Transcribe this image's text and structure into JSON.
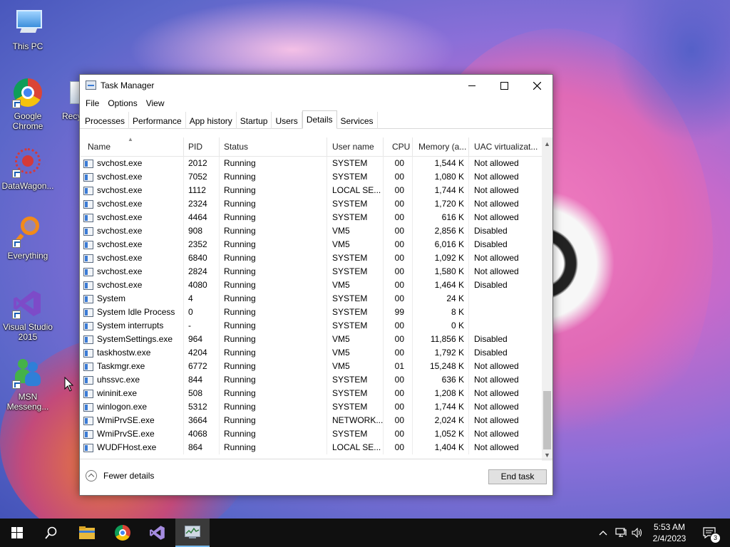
{
  "desktop": {
    "icons": [
      {
        "label": "This PC"
      },
      {
        "label": "Google Chrome"
      },
      {
        "label": "Recy"
      },
      {
        "label": "DataWagon..."
      },
      {
        "label": "Everything"
      },
      {
        "label": "Visual Studio 2015"
      },
      {
        "label": "MSN Messeng..."
      }
    ]
  },
  "window": {
    "title": "Task Manager",
    "menu": [
      "File",
      "Options",
      "View"
    ],
    "tabs": [
      "Processes",
      "Performance",
      "App history",
      "Startup",
      "Users",
      "Details",
      "Services"
    ],
    "active_tab": "Details",
    "columns": {
      "name": "Name",
      "pid": "PID",
      "status": "Status",
      "user": "User name",
      "cpu": "CPU",
      "memory": "Memory (a...",
      "uac": "UAC virtualizat..."
    },
    "rows": [
      {
        "name": "svchost.exe",
        "pid": "2012",
        "status": "Running",
        "user": "SYSTEM",
        "cpu": "00",
        "mem": "1,544 K",
        "uac": "Not allowed"
      },
      {
        "name": "svchost.exe",
        "pid": "7052",
        "status": "Running",
        "user": "SYSTEM",
        "cpu": "00",
        "mem": "1,080 K",
        "uac": "Not allowed"
      },
      {
        "name": "svchost.exe",
        "pid": "1112",
        "status": "Running",
        "user": "LOCAL SE...",
        "cpu": "00",
        "mem": "1,744 K",
        "uac": "Not allowed"
      },
      {
        "name": "svchost.exe",
        "pid": "2324",
        "status": "Running",
        "user": "SYSTEM",
        "cpu": "00",
        "mem": "1,720 K",
        "uac": "Not allowed"
      },
      {
        "name": "svchost.exe",
        "pid": "4464",
        "status": "Running",
        "user": "SYSTEM",
        "cpu": "00",
        "mem": "616 K",
        "uac": "Not allowed"
      },
      {
        "name": "svchost.exe",
        "pid": "908",
        "status": "Running",
        "user": "VM5",
        "cpu": "00",
        "mem": "2,856 K",
        "uac": "Disabled"
      },
      {
        "name": "svchost.exe",
        "pid": "2352",
        "status": "Running",
        "user": "VM5",
        "cpu": "00",
        "mem": "6,016 K",
        "uac": "Disabled"
      },
      {
        "name": "svchost.exe",
        "pid": "6840",
        "status": "Running",
        "user": "SYSTEM",
        "cpu": "00",
        "mem": "1,092 K",
        "uac": "Not allowed"
      },
      {
        "name": "svchost.exe",
        "pid": "2824",
        "status": "Running",
        "user": "SYSTEM",
        "cpu": "00",
        "mem": "1,580 K",
        "uac": "Not allowed"
      },
      {
        "name": "svchost.exe",
        "pid": "4080",
        "status": "Running",
        "user": "VM5",
        "cpu": "00",
        "mem": "1,464 K",
        "uac": "Disabled"
      },
      {
        "name": "System",
        "pid": "4",
        "status": "Running",
        "user": "SYSTEM",
        "cpu": "00",
        "mem": "24 K",
        "uac": ""
      },
      {
        "name": "System Idle Process",
        "pid": "0",
        "status": "Running",
        "user": "SYSTEM",
        "cpu": "99",
        "mem": "8 K",
        "uac": ""
      },
      {
        "name": "System interrupts",
        "pid": "-",
        "status": "Running",
        "user": "SYSTEM",
        "cpu": "00",
        "mem": "0 K",
        "uac": ""
      },
      {
        "name": "SystemSettings.exe",
        "pid": "964",
        "status": "Running",
        "user": "VM5",
        "cpu": "00",
        "mem": "11,856 K",
        "uac": "Disabled"
      },
      {
        "name": "taskhostw.exe",
        "pid": "4204",
        "status": "Running",
        "user": "VM5",
        "cpu": "00",
        "mem": "1,792 K",
        "uac": "Disabled"
      },
      {
        "name": "Taskmgr.exe",
        "pid": "6772",
        "status": "Running",
        "user": "VM5",
        "cpu": "01",
        "mem": "15,248 K",
        "uac": "Not allowed"
      },
      {
        "name": "uhssvc.exe",
        "pid": "844",
        "status": "Running",
        "user": "SYSTEM",
        "cpu": "00",
        "mem": "636 K",
        "uac": "Not allowed"
      },
      {
        "name": "wininit.exe",
        "pid": "508",
        "status": "Running",
        "user": "SYSTEM",
        "cpu": "00",
        "mem": "1,208 K",
        "uac": "Not allowed"
      },
      {
        "name": "winlogon.exe",
        "pid": "5312",
        "status": "Running",
        "user": "SYSTEM",
        "cpu": "00",
        "mem": "1,744 K",
        "uac": "Not allowed"
      },
      {
        "name": "WmiPrvSE.exe",
        "pid": "3664",
        "status": "Running",
        "user": "NETWORK...",
        "cpu": "00",
        "mem": "2,024 K",
        "uac": "Not allowed"
      },
      {
        "name": "WmiPrvSE.exe",
        "pid": "4068",
        "status": "Running",
        "user": "SYSTEM",
        "cpu": "00",
        "mem": "1,052 K",
        "uac": "Not allowed"
      },
      {
        "name": "WUDFHost.exe",
        "pid": "864",
        "status": "Running",
        "user": "LOCAL SE...",
        "cpu": "00",
        "mem": "1,404 K",
        "uac": "Not allowed"
      }
    ],
    "footer": {
      "fewer_details": "Fewer details",
      "end_task": "End task"
    }
  },
  "taskbar": {
    "clock_time": "5:53 AM",
    "clock_date": "2/4/2023",
    "notification_count": "3"
  },
  "colors": {
    "taskbar": "#101010",
    "accent": "#76b9ed"
  }
}
